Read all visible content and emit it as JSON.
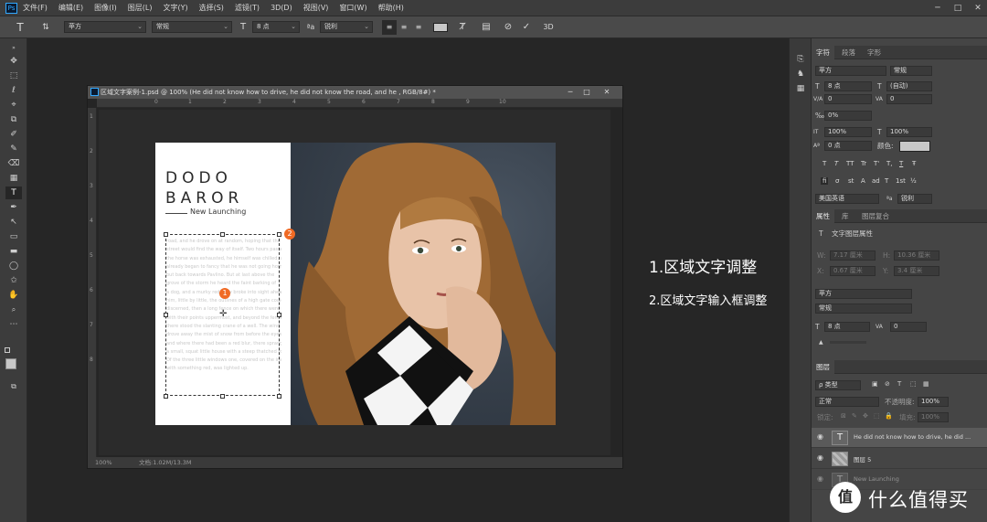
{
  "menubar": {
    "logo": "Ps",
    "items": [
      "文件(F)",
      "编辑(E)",
      "图像(I)",
      "图层(L)",
      "文字(Y)",
      "选择(S)",
      "滤镜(T)",
      "3D(D)",
      "视图(V)",
      "窗口(W)",
      "帮助(H)"
    ],
    "minimize": "─",
    "maximize": "□",
    "close": "✕"
  },
  "options": {
    "tool_icon": "T",
    "font_family": "苹方",
    "font_style": "常规",
    "size_icon": "T",
    "font_size": "8 点",
    "aa_icon": "ªa",
    "antialias": "锐利",
    "color_swatch": "#c8c8c8",
    "warp_icon": "Ⱦ",
    "panel_icon": "▤",
    "cancel_icon": "⊘",
    "commit_icon": "✓",
    "three_d": "3D"
  },
  "tools": [
    "T",
    "✥",
    "⬚",
    "ℓ",
    "⌖",
    "⧉",
    "✐",
    "✎",
    "⌫",
    "▦",
    "T",
    "✒",
    "↖",
    "▭",
    "▬",
    "◯",
    "✋",
    "🔍",
    "⋯"
  ],
  "document": {
    "title": "区域文字案例-1.psd @ 100% (He did not know how to drive, he did not know the road, and he , RGB/8#) *",
    "zoom": "100%",
    "status": "文档:1.02M/13.3M",
    "hruler": [
      "0",
      "1",
      "2",
      "3",
      "4",
      "5",
      "6",
      "7",
      "8",
      "9",
      "10"
    ],
    "vruler": [
      "1",
      "2",
      "3",
      "4",
      "5",
      "6",
      "7",
      "8"
    ],
    "min": "─",
    "max": "□",
    "close": "✕"
  },
  "artwork": {
    "brand_line1": "DODO",
    "brand_line2": "BAROR",
    "brand_sub": "New Launching",
    "paragraph": [
      "road, and he drove on at random, hoping that the",
      "street would find the way of itself. Two hours passed,",
      "the horse was exhausted, he himself was chilled, and",
      "already began to fancy that he was not going home,",
      "but back towards Pavlino. But at last above the",
      "grove of the storm he heard the faint barking of",
      "a dog, and a murky red glow broke into sight ahead of",
      "him, little by little, the outlines of a high gate could be",
      "discerned, then a long fence on which there were nails",
      "with their points uppermost, and beyond the fence",
      "there stood the slanting crane of a well. The wind",
      "drove away the mist of snow from before the eyes,",
      "and where there had been a red blur, there sprang up",
      "a small, squat little house with a steep thatched roof.",
      "Of the three little windows one, covered on the inside",
      "with something red, was lighted up."
    ],
    "badge1": "1",
    "badge2": "2"
  },
  "notes": {
    "note1": "1.区域文字调整",
    "note2": "2.区域文字输入框调整"
  },
  "iconstrip": [
    "⎘",
    "♞",
    "▦"
  ],
  "char_panel": {
    "tabs": [
      "字符",
      "段落",
      "字形"
    ],
    "font_family": "苹方",
    "font_style": "常规",
    "size_label": "T",
    "size": "8 点",
    "leading_label": "T",
    "leading": "(自动)",
    "kern_label": "V/A",
    "kern": "0",
    "track_label": "VA",
    "track": "0",
    "scale_label": "‰",
    "scale": "0%",
    "vscale_label": "IT",
    "vscale": "100%",
    "hscale_label": "T",
    "hscale": "100%",
    "baseline_label": "Aª",
    "baseline": "0 点",
    "color_label": "颜色:",
    "color": "#c8c8c8",
    "styles": [
      "T",
      "T",
      "TT",
      "Tr",
      "T'",
      "T,",
      "T",
      "Ŧ"
    ],
    "ot": [
      "fi",
      "σ",
      "st",
      "A",
      "ad",
      "T",
      "1st",
      "½"
    ],
    "language": "美国英语",
    "aa_label": "ªa",
    "antialias": "锐利"
  },
  "props_panel": {
    "tabs": [
      "属性",
      "库",
      "图层复合"
    ],
    "title_icon": "T",
    "title": "文字图层属性",
    "w_label": "W:",
    "w": "7.17 厘米",
    "h_label": "H:",
    "h": "10.36 厘米",
    "x_label": "X:",
    "x": "0.67 厘米",
    "y_label": "Y:",
    "y": "3.4 厘米",
    "font_family": "苹方",
    "font_style": "常规",
    "size_label": "T",
    "size": "8 点",
    "track_label": "VA",
    "track": "0",
    "align_label": "▲"
  },
  "layers_panel": {
    "tab": "图层",
    "search": "ρ 类型",
    "filter_icons": [
      "▣",
      "⊘",
      "T",
      "⬚",
      "▦"
    ],
    "blend": "正常",
    "opacity_label": "不透明度:",
    "opacity": "100%",
    "lock_label": "锁定:",
    "lock_icons": [
      "⊠",
      "✎",
      "✥",
      "⬚",
      "🔒"
    ],
    "fill_label": "填充:",
    "fill": "100%",
    "layers": [
      {
        "name": "He did not know how to drive, he did ...",
        "thumb": "T",
        "selected": true
      },
      {
        "name": "图层 5",
        "thumb": "",
        "selected": false
      },
      {
        "name": "New Launching",
        "thumb": "T",
        "selected": false
      }
    ],
    "eye": "👁"
  },
  "watermark": {
    "logo": "值",
    "text": "什么值得买"
  }
}
